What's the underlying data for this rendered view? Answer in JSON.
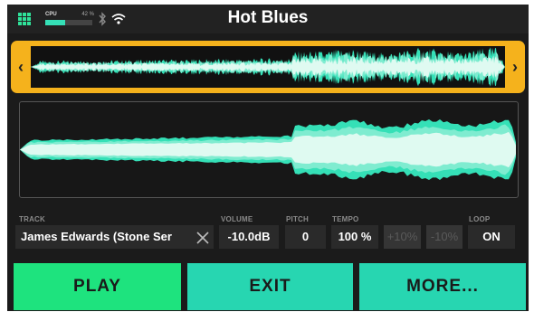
{
  "header": {
    "title": "Hot Blues",
    "cpu_label": "CPU",
    "cpu_percent_text": "42 %",
    "cpu_level": 0.42,
    "icons": [
      "grid-menu-icon",
      "bluetooth-icon",
      "wifi-icon"
    ]
  },
  "waveform": {
    "overview_nav_left": "‹",
    "overview_nav_right": "›",
    "accent_color": "#f5b21c",
    "wave_colors": [
      "#35e0b7",
      "#7fecd0",
      "#dffaf1"
    ]
  },
  "params": {
    "track": {
      "label": "TRACK",
      "value": "James Edwards (Stone Ser"
    },
    "volume": {
      "label": "VOLUME",
      "value": "-10.0dB"
    },
    "pitch": {
      "label": "PITCH",
      "value": "0"
    },
    "tempo": {
      "label": "TEMPO",
      "value": "100 %",
      "plus": "+10%",
      "minus": "-10%"
    },
    "loop": {
      "label": "LOOP",
      "value": "ON"
    }
  },
  "buttons": {
    "play": "PLAY",
    "exit": "EXIT",
    "more": "MORE...",
    "colors": {
      "play": "#1ee37e",
      "exit": "#27d6b1",
      "more": "#27d6b1"
    }
  }
}
